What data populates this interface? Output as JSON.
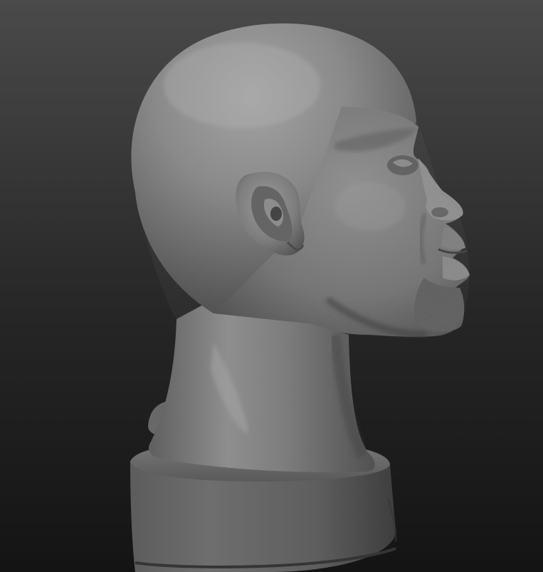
{
  "scene": {
    "subject": "sculpted-head-bust-profile",
    "colors": {
      "background_top": "#4a4a4a",
      "background_bottom": "#141414",
      "clay_light": "#a6a6a6",
      "clay_mid": "#7c7c7c",
      "clay_dark": "#3a3a3a"
    }
  }
}
